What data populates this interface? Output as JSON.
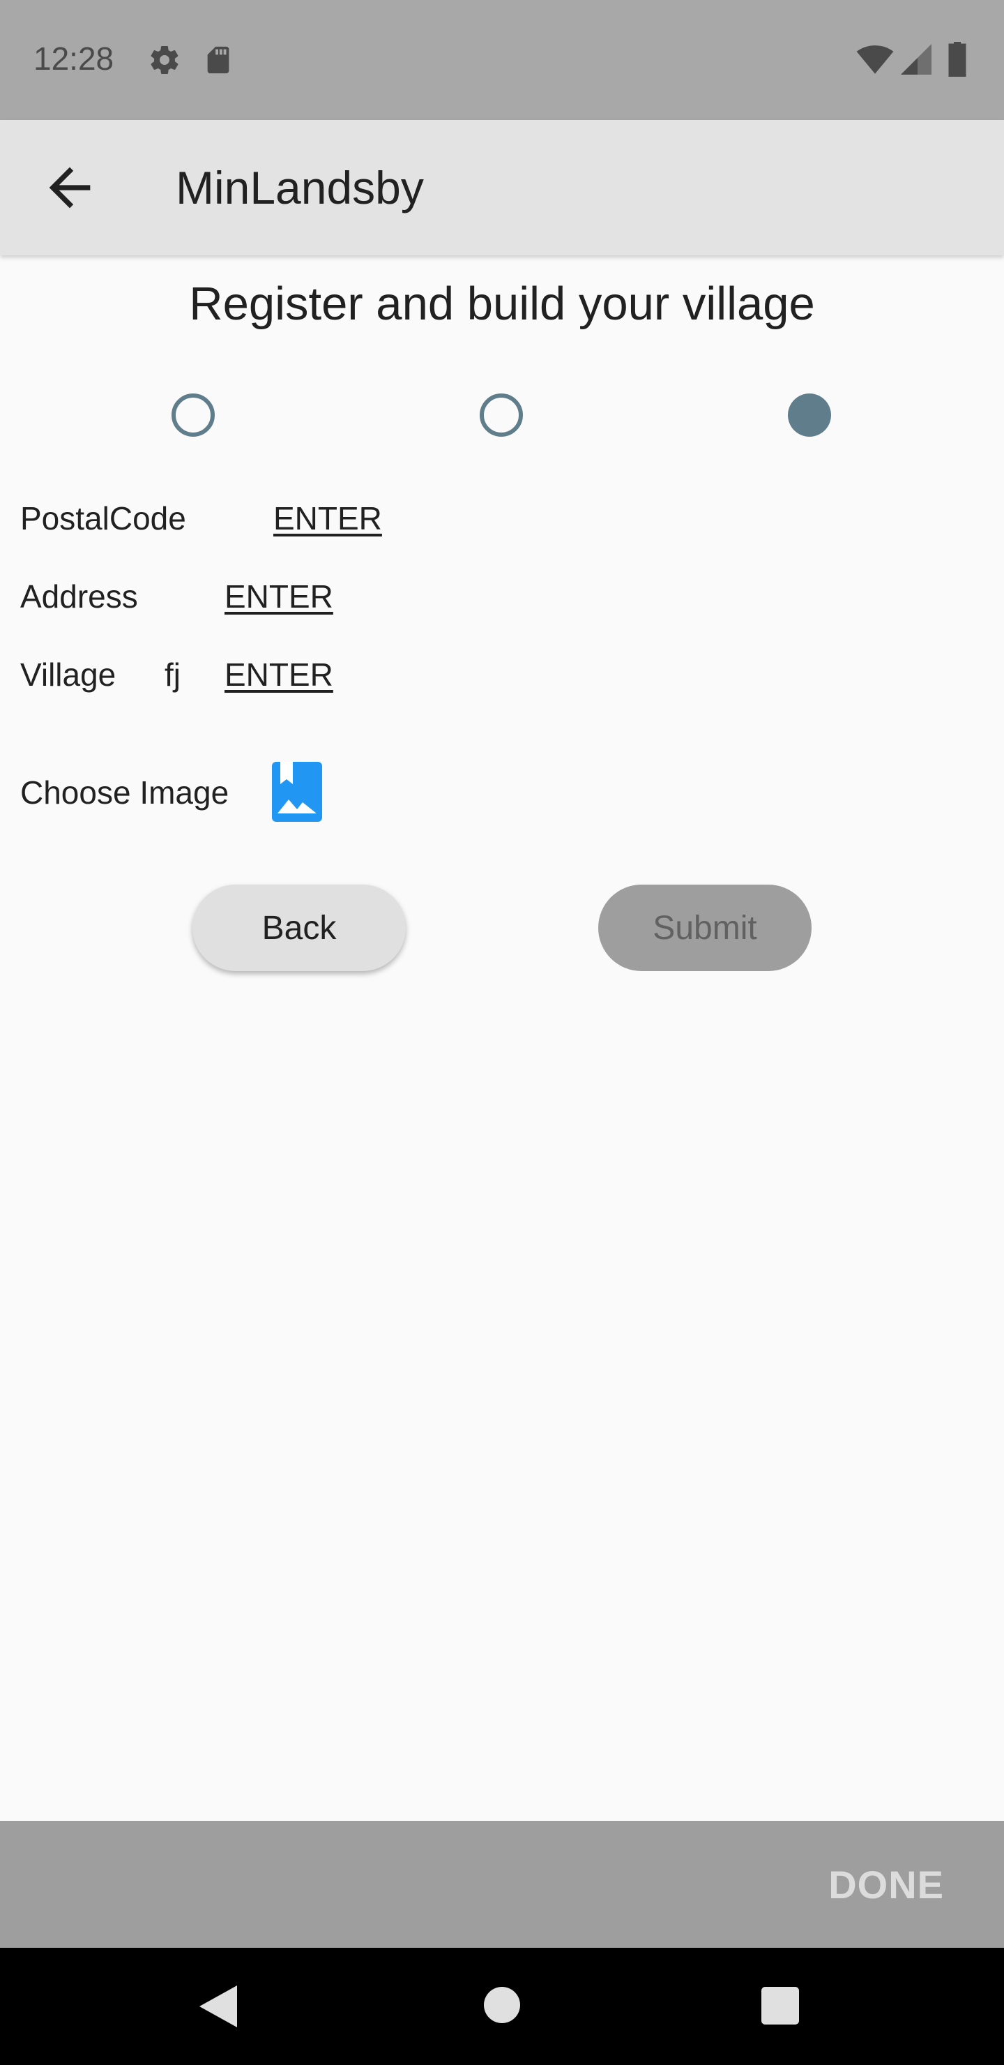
{
  "status_bar": {
    "time": "12:28",
    "left_icons": [
      "gear-icon",
      "sd-card-icon"
    ],
    "right_icons": [
      "wifi-icon",
      "signal-icon",
      "battery-icon"
    ]
  },
  "app_bar": {
    "back_icon": "arrow-back-icon",
    "title": "MinLandsby"
  },
  "page": {
    "heading": "Register and build your village",
    "steps": [
      {
        "state": "inactive"
      },
      {
        "state": "inactive"
      },
      {
        "state": "active"
      }
    ],
    "fields": [
      {
        "label": "PostalCode",
        "value": "",
        "action": "ENTER"
      },
      {
        "label": "Address",
        "value": "",
        "action": "ENTER"
      },
      {
        "label": "Village",
        "value": "fj",
        "action": "ENTER"
      }
    ],
    "choose_image_label": "Choose Image",
    "choose_image_icon": "image-icon",
    "back_button": "Back",
    "submit_button": "Submit"
  },
  "keyboard_bar": {
    "done_label": "DONE"
  },
  "nav_bar": {
    "buttons": [
      "back-triangle-icon",
      "home-circle-icon",
      "recents-square-icon"
    ]
  },
  "colors": {
    "status_bar": "#a8a8a8",
    "app_bar": "#e3e3e3",
    "step_accent": "#607d8b",
    "image_icon": "#2196f3",
    "submit_disabled": "#9e9e9e"
  }
}
